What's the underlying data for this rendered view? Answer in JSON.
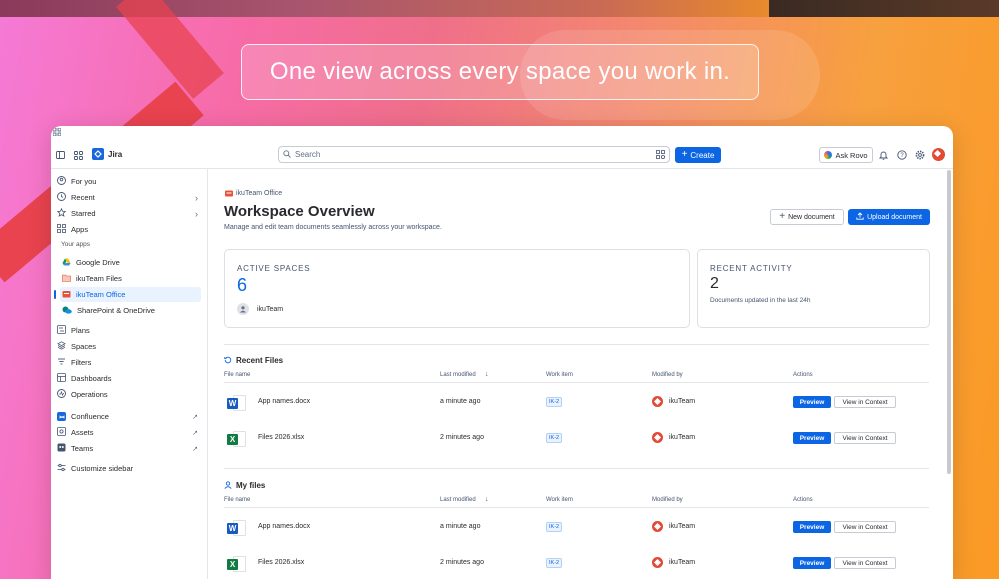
{
  "banner": {
    "text": "One view across every space you work in."
  },
  "topnav": {
    "app_name": "Jira",
    "search_placeholder": "Search",
    "create_label": "Create",
    "ask_rovo_label": "Ask Rovo"
  },
  "sidebar": {
    "items": [
      {
        "label": "For you"
      },
      {
        "label": "Recent"
      },
      {
        "label": "Starred"
      },
      {
        "label": "Apps"
      }
    ],
    "your_apps_label": "Your apps",
    "apps": [
      {
        "label": "Google Drive"
      },
      {
        "label": "ikuTeam Files"
      },
      {
        "label": "ikuTeam Office"
      },
      {
        "label": "SharePoint & OneDrive"
      }
    ],
    "nav": [
      {
        "label": "Plans"
      },
      {
        "label": "Spaces"
      },
      {
        "label": "Filters"
      },
      {
        "label": "Dashboards"
      },
      {
        "label": "Operations"
      }
    ],
    "external": [
      {
        "label": "Confluence"
      },
      {
        "label": "Assets"
      },
      {
        "label": "Teams"
      }
    ],
    "customize_label": "Customize sidebar"
  },
  "main": {
    "breadcrumb": "ikuTeam Office",
    "title": "Workspace Overview",
    "subtitle": "Manage and edit team documents seamlessly across your workspace.",
    "new_document_label": "New document",
    "upload_document_label": "Upload document",
    "active_spaces": {
      "label": "ACTIVE SPACES",
      "value": "6",
      "member": "ikuTeam"
    },
    "recent_activity": {
      "label": "RECENT ACTIVITY",
      "value": "2",
      "caption": "Documents updated in the last 24h"
    },
    "columns": {
      "file_name": "File name",
      "last_modified": "Last modified",
      "work_item": "Work item",
      "modified_by": "Modified by",
      "actions": "Actions"
    },
    "preview_label": "Preview",
    "view_in_context_label": "View in Context",
    "recent_files": {
      "title": "Recent Files",
      "rows": [
        {
          "type": "word",
          "name": "App names.docx",
          "modified": "a minute ago",
          "work_item": "IK-2",
          "by": "ikuTeam"
        },
        {
          "type": "excel",
          "name": "Files 2026.xlsx",
          "modified": "2 minutes ago",
          "work_item": "IK-2",
          "by": "ikuTeam"
        }
      ]
    },
    "my_files": {
      "title": "My files",
      "rows": [
        {
          "type": "word",
          "name": "App names.docx",
          "modified": "a minute ago",
          "work_item": "IK-2",
          "by": "ikuTeam"
        },
        {
          "type": "excel",
          "name": "Files 2026.xlsx",
          "modified": "2 minutes ago",
          "work_item": "IK-2",
          "by": "ikuTeam"
        }
      ]
    }
  },
  "colors": {
    "accent": "#0c66e4",
    "word": "#185abd",
    "excel": "#107c41",
    "avatar": "#e34935"
  }
}
